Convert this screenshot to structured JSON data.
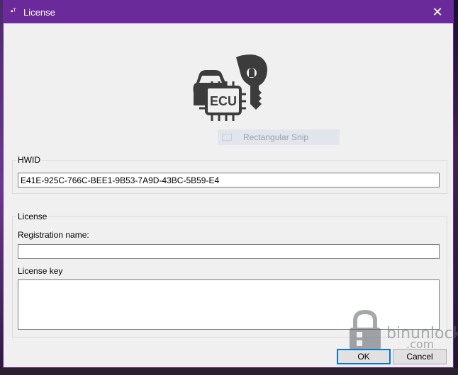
{
  "window": {
    "title": "License",
    "close_glyph": "✕",
    "app_icon": "app-icon"
  },
  "logo": {
    "icon": "ecu-car-key-logo",
    "chip_text": "ECU"
  },
  "overlay": {
    "snip_label": "Rectangular Snip"
  },
  "hwid_group": {
    "label": "HWID",
    "value": "E41E-925C-766C-BEE1-9B53-7A9D-43BC-5B59-E4"
  },
  "license_group": {
    "label": "License",
    "registration_label": "Registration name:",
    "registration_value": "",
    "key_label": "License key",
    "key_value": ""
  },
  "buttons": {
    "ok": "OK",
    "cancel": "Cancel"
  },
  "watermark": {
    "text": "binunlock",
    "suffix": ".com"
  },
  "colors": {
    "titlebar": "#6b2a9a",
    "logo": "#3c3c3c",
    "focus": "#0078d7"
  }
}
